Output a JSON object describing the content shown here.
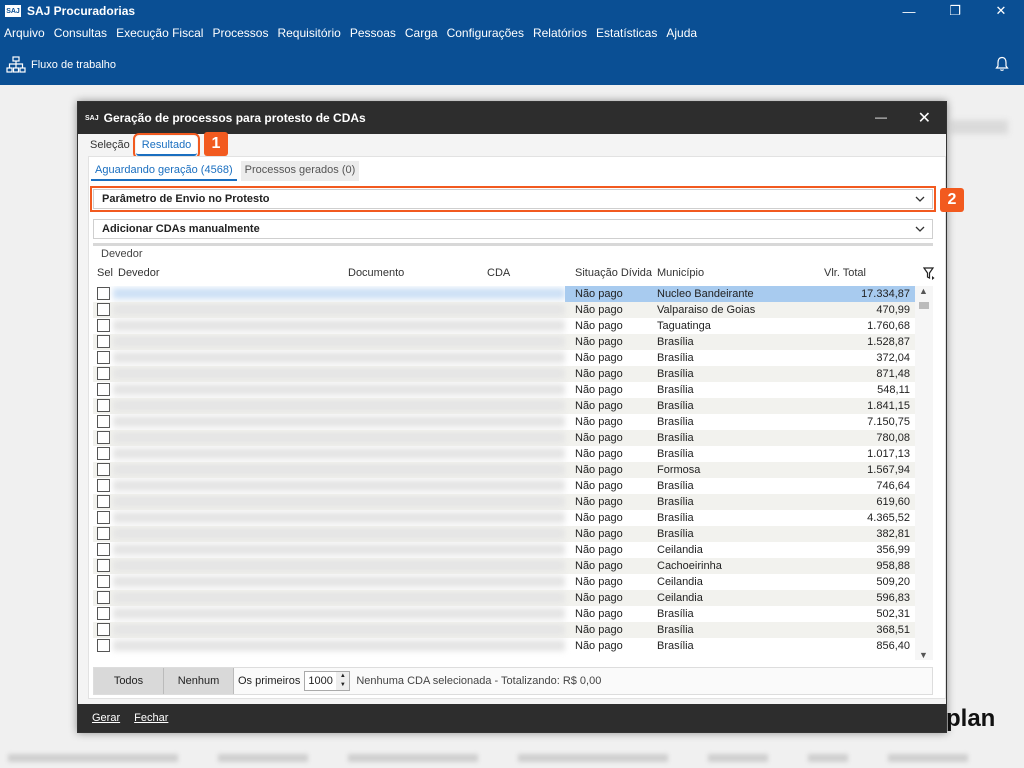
{
  "app": {
    "title": "SAJ Procuradorias",
    "logo": "SAJ"
  },
  "menu": [
    "Arquivo",
    "Consultas",
    "Execução Fiscal",
    "Processos",
    "Requisitório",
    "Pessoas",
    "Carga",
    "Configurações",
    "Relatórios",
    "Estatísticas",
    "Ajuda"
  ],
  "toolbar": {
    "workflow_label": "Fluxo de trabalho"
  },
  "background": {
    "brand_text": "plan"
  },
  "dialog": {
    "logo": "SAJ",
    "title": "Geração de processos para protesto de CDAs",
    "tabs": [
      "Seleção",
      "Resultado"
    ],
    "subtabs": [
      "Aguardando geração (4568)",
      "Processos gerados (0)"
    ],
    "sections": [
      "Parâmetro de Envio no Protesto",
      "Adicionar CDAs manualmente"
    ],
    "group_label": "Devedor",
    "columns": [
      "Sel",
      "Devedor",
      "Documento",
      "CDA",
      "Situação Dívida",
      "Município",
      "Vlr. Total"
    ],
    "rows": [
      {
        "situacao": "Não pago",
        "municipio": "Nucleo Bandeirante",
        "valor": "17.334,87"
      },
      {
        "situacao": "Não pago",
        "municipio": "Valparaiso de Goias",
        "valor": "470,99"
      },
      {
        "situacao": "Não pago",
        "municipio": "Taguatinga",
        "valor": "1.760,68"
      },
      {
        "situacao": "Não pago",
        "municipio": "Brasília",
        "valor": "1.528,87"
      },
      {
        "situacao": "Não pago",
        "municipio": "Brasília",
        "valor": "372,04"
      },
      {
        "situacao": "Não pago",
        "municipio": "Brasília",
        "valor": "871,48"
      },
      {
        "situacao": "Não pago",
        "municipio": "Brasília",
        "valor": "548,11"
      },
      {
        "situacao": "Não pago",
        "municipio": "Brasília",
        "valor": "1.841,15"
      },
      {
        "situacao": "Não pago",
        "municipio": "Brasília",
        "valor": "7.150,75"
      },
      {
        "situacao": "Não pago",
        "municipio": "Brasília",
        "valor": "780,08"
      },
      {
        "situacao": "Não pago",
        "municipio": "Brasília",
        "valor": "1.017,13"
      },
      {
        "situacao": "Não pago",
        "municipio": "Formosa",
        "valor": "1.567,94"
      },
      {
        "situacao": "Não pago",
        "municipio": "Brasília",
        "valor": "746,64"
      },
      {
        "situacao": "Não pago",
        "municipio": "Brasília",
        "valor": "619,60"
      },
      {
        "situacao": "Não pago",
        "municipio": "Brasília",
        "valor": "4.365,52"
      },
      {
        "situacao": "Não pago",
        "municipio": "Brasília",
        "valor": "382,81"
      },
      {
        "situacao": "Não pago",
        "municipio": "Ceilandia",
        "valor": "356,99"
      },
      {
        "situacao": "Não pago",
        "municipio": "Cachoeirinha",
        "valor": "958,88"
      },
      {
        "situacao": "Não pago",
        "municipio": "Ceilandia",
        "valor": "509,20"
      },
      {
        "situacao": "Não pago",
        "municipio": "Ceilandia",
        "valor": "596,83"
      },
      {
        "situacao": "Não pago",
        "municipio": "Brasília",
        "valor": "502,31"
      },
      {
        "situacao": "Não pago",
        "municipio": "Brasília",
        "valor": "368,51"
      },
      {
        "situacao": "Não pago",
        "municipio": "Brasília",
        "valor": "856,40"
      }
    ],
    "footer": {
      "all_label": "Todos",
      "none_label": "Nenhum",
      "first_label": "Os primeiros",
      "first_value": "1000",
      "status": "Nenhuma CDA selecionada - Totalizando: R$ 0,00"
    },
    "actions": [
      "Gerar",
      "Fechar"
    ]
  },
  "annotations": [
    "1",
    "2"
  ],
  "colors": {
    "brand_blue": "#0a4f94",
    "highlight_orange": "#f25a1f",
    "selection_blue": "#a8cbef"
  }
}
